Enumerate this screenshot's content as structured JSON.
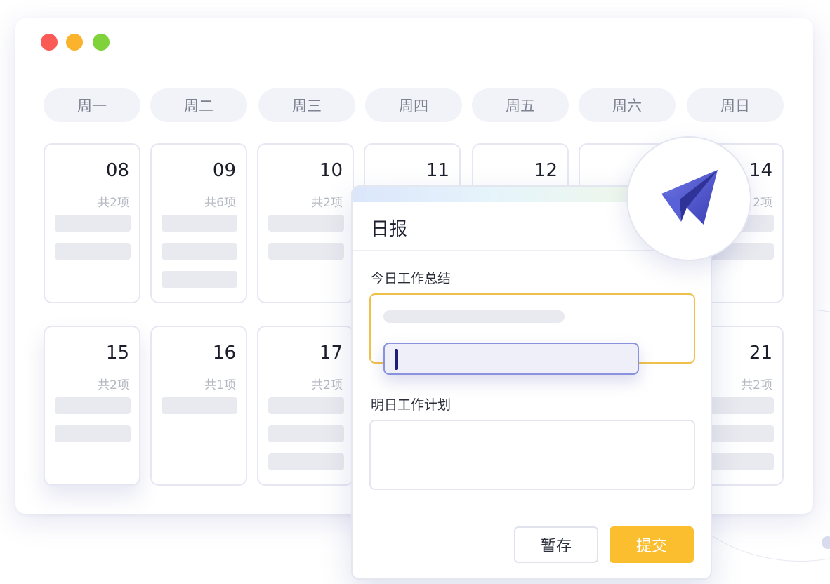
{
  "window": {
    "traffic_lights": [
      {
        "name": "close",
        "color": "#fb5b57"
      },
      {
        "name": "minimize",
        "color": "#fbb22d"
      },
      {
        "name": "zoom",
        "color": "#80d23a"
      }
    ]
  },
  "calendar": {
    "weekdays": [
      "周一",
      "周二",
      "周三",
      "周四",
      "周五",
      "周六",
      "周日"
    ],
    "week1": [
      {
        "day": "08",
        "count": "共2项"
      },
      {
        "day": "09",
        "count": "共6项"
      },
      {
        "day": "10",
        "count": "共2项"
      },
      {
        "day": "11",
        "count": ""
      },
      {
        "day": "12",
        "count": ""
      },
      {
        "day": "",
        "count": ""
      },
      {
        "day": "14",
        "count": "2项"
      }
    ],
    "week2": [
      {
        "day": "15",
        "count": "共2项"
      },
      {
        "day": "16",
        "count": "共1项"
      },
      {
        "day": "17",
        "count": "共2项"
      },
      {
        "day": "21",
        "count": "共2项"
      }
    ]
  },
  "modal": {
    "title": "日报",
    "summary_label": "今日工作总结",
    "plan_label": "明日工作计划",
    "draft_button": "暂存",
    "submit_button": "提交",
    "active_border_color": "#f0c14a",
    "submit_color": "#fbbe2e"
  },
  "icons": {
    "badge": "paper-plane-icon"
  },
  "colors": {
    "accent_indigo": "#4a4fc4",
    "caret": "#1f1c7a"
  }
}
